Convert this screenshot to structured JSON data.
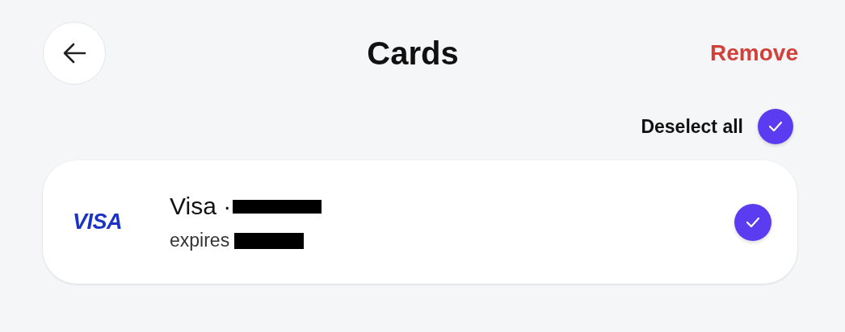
{
  "header": {
    "title": "Cards",
    "action": "Remove"
  },
  "select_all": {
    "label": "Deselect all",
    "checked": true
  },
  "cards": [
    {
      "brand": "VISA",
      "name": "Visa ·",
      "expiry": "expires",
      "selected": true
    }
  ]
}
